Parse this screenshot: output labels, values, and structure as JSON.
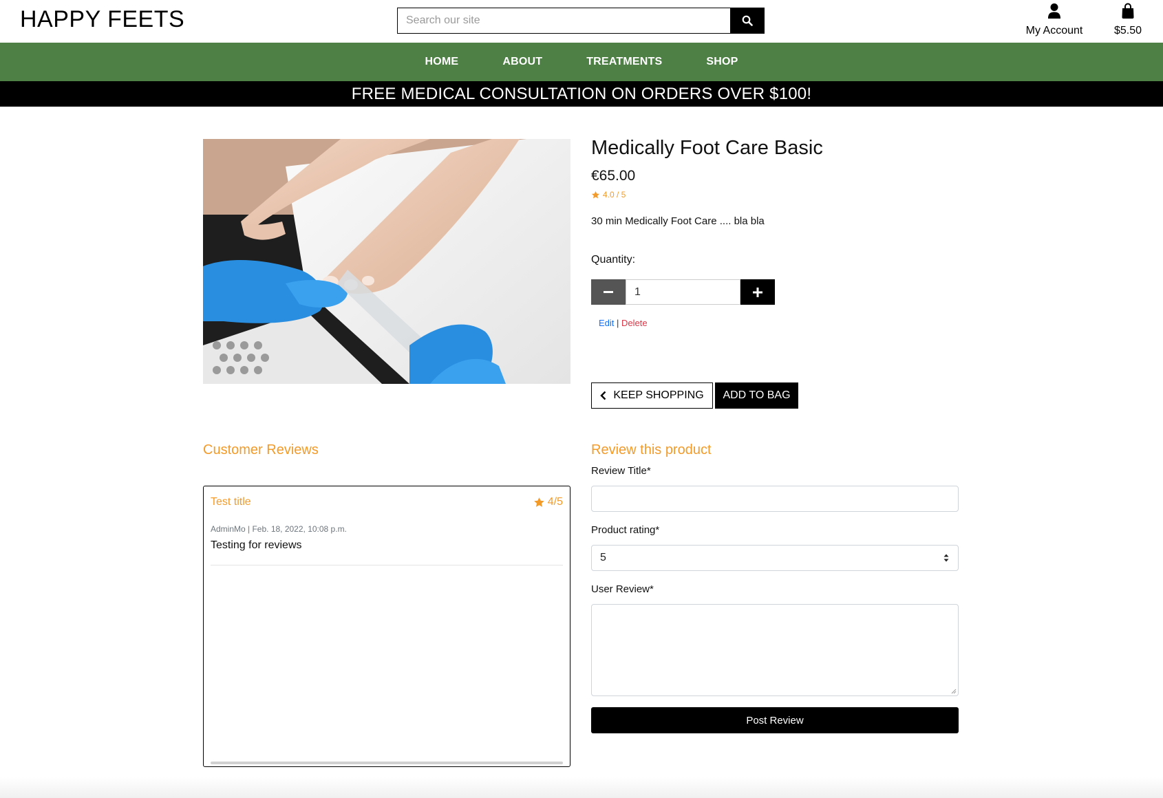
{
  "header": {
    "logo": "HAPPY FEETS",
    "search_placeholder": "Search our site",
    "account_label": "My Account",
    "bag_total": "$5.50"
  },
  "nav": {
    "items": [
      "HOME",
      "ABOUT",
      "TREATMENTS",
      "SHOP"
    ]
  },
  "banner": "FREE MEDICAL CONSULTATION ON ORDERS OVER $100!",
  "product": {
    "title": "Medically Foot Care Basic",
    "price": "€65.00",
    "rating": "4.0 / 5",
    "description": "30 min Medically Foot Care .... bla bla",
    "quantity_label": "Quantity:",
    "quantity_value": "1",
    "edit_label": "Edit",
    "separator": "|",
    "delete_label": "Delete",
    "keep_shopping_label": "KEEP SHOPPING",
    "add_to_bag_label": "ADD TO BAG"
  },
  "reviews": {
    "heading": "Customer Reviews",
    "items": [
      {
        "title": "Test title",
        "rating": "4/5",
        "meta": "AdminMo | Feb. 18, 2022, 10:08 p.m.",
        "body": "Testing for reviews"
      }
    ]
  },
  "review_form": {
    "heading": "Review this product",
    "title_label": "Review Title*",
    "title_value": "",
    "rating_label": "Product rating*",
    "rating_value": "5",
    "review_label": "User Review*",
    "review_value": "",
    "submit_label": "Post Review"
  },
  "colors": {
    "nav_green": "#4e8046",
    "accent_orange": "#f39b2a",
    "edit_blue": "#0d6efd",
    "delete_red": "#dc3545"
  }
}
